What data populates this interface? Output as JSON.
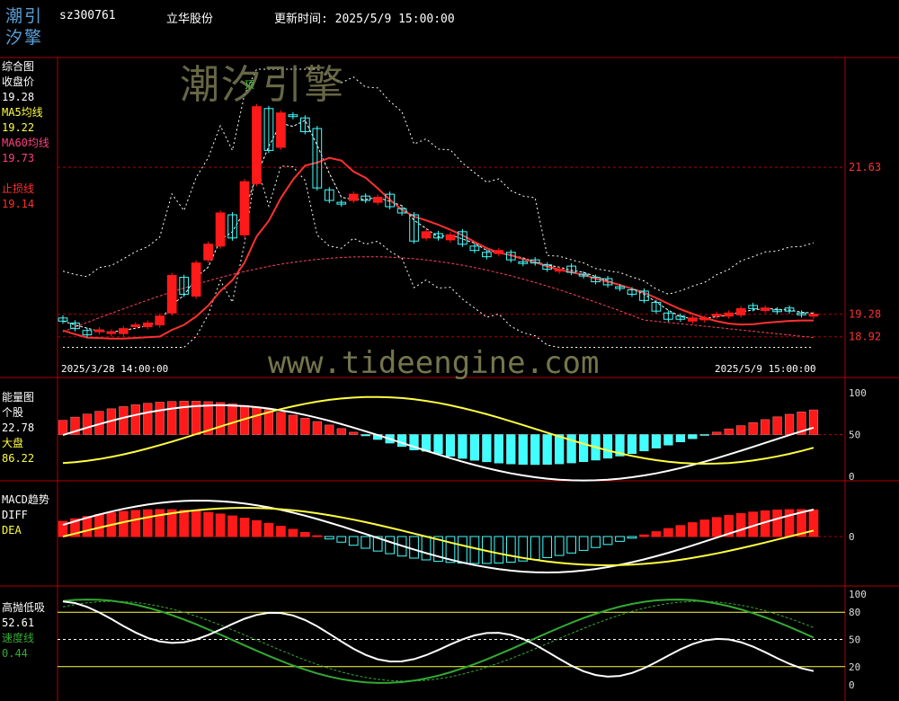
{
  "header": {
    "logo_line1": "潮引",
    "logo_line2": "汐擎",
    "code": "sz300761",
    "name": "立华股份",
    "update_label": "更新时间: 2025/5/9 15:00:00"
  },
  "watermark": {
    "title": "潮汐引擎",
    "url": "www.tideengine.com"
  },
  "colors": {
    "up": "#ff1a1a",
    "down": "#40ffff",
    "ma5": "#ffff40",
    "ma60": "#ff4060",
    "stop": "#ff3030",
    "grid": "#b00000",
    "axis": "#ff3030",
    "speed": "#33aa33"
  },
  "panel_main": {
    "title": "综合图",
    "close_label": "收盘价",
    "close_value": "19.28",
    "ma5_label": "MA5均线",
    "ma5_value": "19.22",
    "ma60_label": "MA60均线",
    "ma60_value": "19.73",
    "stop_label": "止损线",
    "stop_value": "19.14",
    "top_marker": "顶",
    "date_start": "2025/3/28 14:00:00",
    "date_end": "2025/5/9 15:00:00"
  },
  "panel_energy": {
    "title": "能量图",
    "stock_label": "个股",
    "stock_value": "22.78",
    "market_label": "大盘",
    "market_value": "86.22"
  },
  "panel_macd": {
    "title": "MACD趋势",
    "diff_label": "DIFF",
    "dea_label": "DEA"
  },
  "panel_hilo": {
    "title": "高抛低吸",
    "value": "52.61",
    "speed_label": "速度线",
    "speed_value": "0.44"
  },
  "chart_data": [
    {
      "type": "candlestick",
      "title": "综合图",
      "ylim": [
        18.7,
        23.3
      ],
      "x_range": [
        "2025/3/28 14:00:00",
        "2025/5/9 15:00:00"
      ],
      "y_ticks": [
        21.63,
        19.28,
        18.92
      ],
      "series": [
        {
          "name": "收盘价",
          "values": [
            19.17,
            19.05,
            18.95,
            19.03,
            19.0,
            19.05,
            19.11,
            19.14,
            19.25,
            19.9,
            19.6,
            20.1,
            20.4,
            20.9,
            20.5,
            21.4,
            22.6,
            21.9,
            22.5,
            22.45,
            22.2,
            21.3,
            21.1,
            21.05,
            21.2,
            21.1,
            21.15,
            21.0,
            20.9,
            20.45,
            20.6,
            20.5,
            20.55,
            20.4,
            20.3,
            20.2,
            20.3,
            20.15,
            20.1,
            20.1,
            20.0,
            20.0,
            19.95,
            19.9,
            19.8,
            19.75,
            19.7,
            19.6,
            19.5,
            19.33,
            19.2,
            19.2,
            19.22,
            19.22,
            19.28,
            19.3,
            19.37,
            19.37,
            19.38,
            19.33,
            19.33,
            19.28,
            19.28
          ]
        }
      ],
      "overlays": [
        "MA5均线",
        "MA60均线",
        "止损线"
      ],
      "annotations": [
        "顶"
      ]
    },
    {
      "type": "bar",
      "title": "能量图",
      "ylim": [
        0,
        100
      ],
      "y_ticks": [
        100,
        50,
        0
      ],
      "series": [
        {
          "name": "个股",
          "values": [
            22.78
          ]
        },
        {
          "name": "大盘",
          "values": [
            86.22
          ]
        }
      ]
    },
    {
      "type": "bar",
      "title": "MACD趋势",
      "y_ticks": [
        0
      ],
      "series": [
        {
          "name": "DIFF"
        },
        {
          "name": "DEA"
        }
      ]
    },
    {
      "type": "line",
      "title": "高抛低吸",
      "ylim": [
        0,
        100
      ],
      "y_ticks": [
        100,
        80,
        50,
        20,
        0
      ],
      "series": [
        {
          "name": "高抛低吸",
          "values": [
            52.61
          ]
        },
        {
          "name": "速度线",
          "values": [
            0.44
          ]
        }
      ]
    }
  ]
}
